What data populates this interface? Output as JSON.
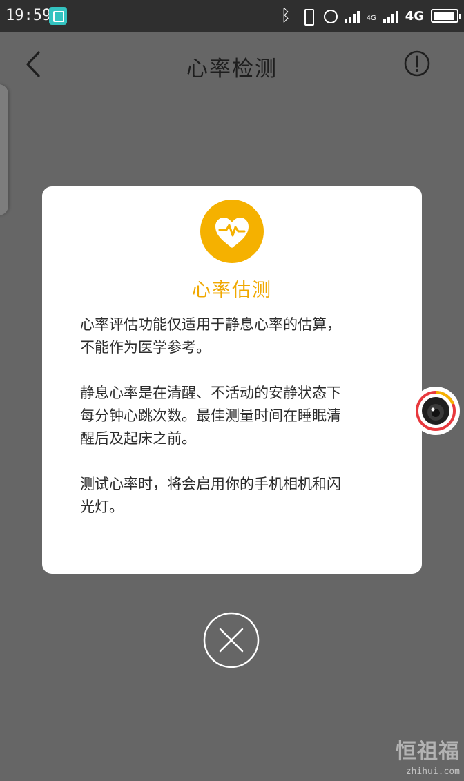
{
  "status_bar": {
    "time": "19:59",
    "icons": [
      "screenshot-icon",
      "bluetooth-icon",
      "vibrate-icon",
      "alarm-icon",
      "signal-icon",
      "signal-icon",
      "battery-icon"
    ],
    "network_small": "4G",
    "network_label": "4G",
    "battery_level": 0.92
  },
  "nav": {
    "title": "心率检测",
    "back_icon": "chevron-left-icon",
    "info_icon": "exclamation-circle-icon"
  },
  "dialog": {
    "badge_icon": "heart-pulse-icon",
    "badge_color": "#f5b100",
    "title": "心率估测",
    "title_color": "#f0a800",
    "paragraphs": [
      [
        "心率评估功能仅适用于静息心率的估算，",
        "不能作为医学参考。"
      ],
      [
        "静息心率是在清醒、不活动的安静状态下",
        "每分钟心跳次数。最佳测量时间在睡眠清",
        "醒后及起床之前。"
      ],
      [
        "测试心率时，将会启用你的手机相机和闪",
        "光灯。"
      ]
    ]
  },
  "close_button": {
    "icon": "close-icon"
  },
  "floating_camera": {
    "icon": "camera-lens-icon",
    "ring_color": "#e8383d"
  },
  "watermark": {
    "text": "恒祖福",
    "url": "zhihui.com"
  }
}
